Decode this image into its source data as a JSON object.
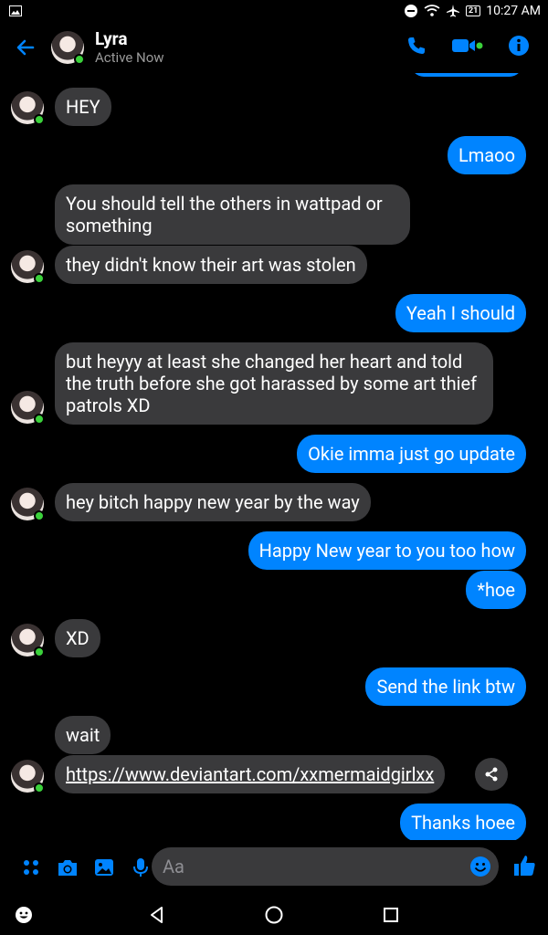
{
  "status": {
    "battery": "21",
    "time": "10:27 AM"
  },
  "header": {
    "title": "Lyra",
    "subtitle": "Active Now"
  },
  "messages": [
    {
      "side": "in",
      "text": "HEY"
    },
    {
      "side": "out",
      "text": "Lmaoo"
    },
    {
      "side": "in",
      "text": "You should tell the others in wattpad or something"
    },
    {
      "side": "in",
      "text": "they didn't know their art was stolen"
    },
    {
      "side": "out",
      "text": "Yeah I should"
    },
    {
      "side": "in",
      "text": "but heyyy at least she changed her heart and told the truth before she got harassed by some art thief patrols XD"
    },
    {
      "side": "out",
      "text": "Okie imma just go update"
    },
    {
      "side": "in",
      "text": "hey bitch happy new year by the way"
    },
    {
      "side": "out",
      "text": "Happy New year to you too how"
    },
    {
      "side": "out",
      "text": "*hoe"
    },
    {
      "side": "in",
      "text": "XD"
    },
    {
      "side": "out",
      "text": "Send the link btw"
    },
    {
      "side": "in",
      "text": "wait"
    },
    {
      "side": "in",
      "text": "https://www.deviantart.com/xxmermaidgirlxx"
    },
    {
      "side": "out",
      "text": "Thanks hoee"
    }
  ],
  "composer": {
    "placeholder": "Aa"
  },
  "colors": {
    "accent": "#0084ff",
    "incoming_bubble": "#3a3a3c",
    "background": "#000000",
    "online": "#3bd13b"
  }
}
